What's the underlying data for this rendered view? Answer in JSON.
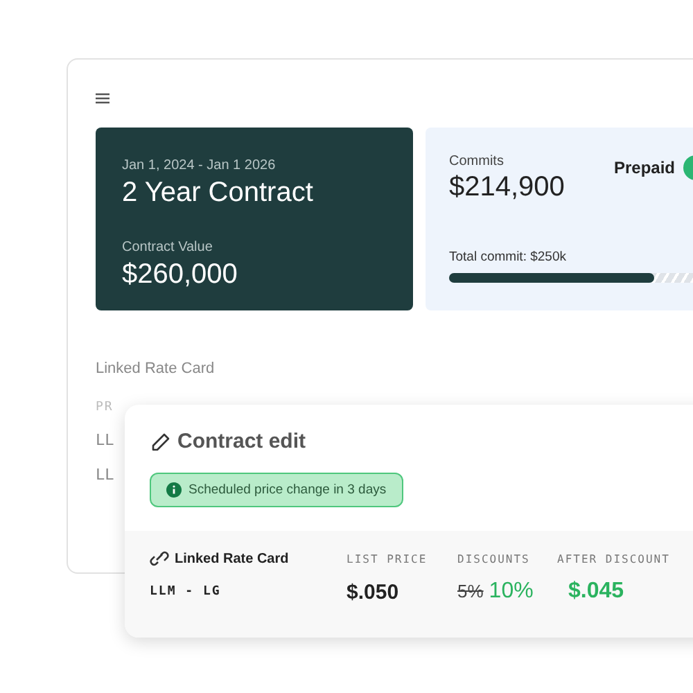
{
  "contract_card": {
    "dates": "Jan 1, 2024 - Jan 1 2026",
    "title": "2 Year Contract",
    "value_label": "Contract Value",
    "value": "$260,000"
  },
  "commits_card": {
    "label": "Commits",
    "amount": "$214,900",
    "toggle": {
      "label": "Prepaid",
      "on": true
    },
    "total": "Total commit: $250k",
    "level": 0.81
  },
  "rate_card": {
    "title": "Linked Rate Card",
    "column_1": "PR",
    "rows": [
      "LL",
      "LL"
    ]
  },
  "edit_panel": {
    "title": "Contract edit",
    "notice": "Scheduled price change in 3 days",
    "table": {
      "name_header": "Linked Rate Card",
      "columns": [
        "LIST PRICE",
        "DISCOUNTS",
        "AFTER DISCOUNT"
      ],
      "row": {
        "name": "LLM - LG",
        "list_price": "$.050",
        "old_discount": "5%",
        "discount": "10%",
        "after_discount": "$.045"
      }
    }
  }
}
